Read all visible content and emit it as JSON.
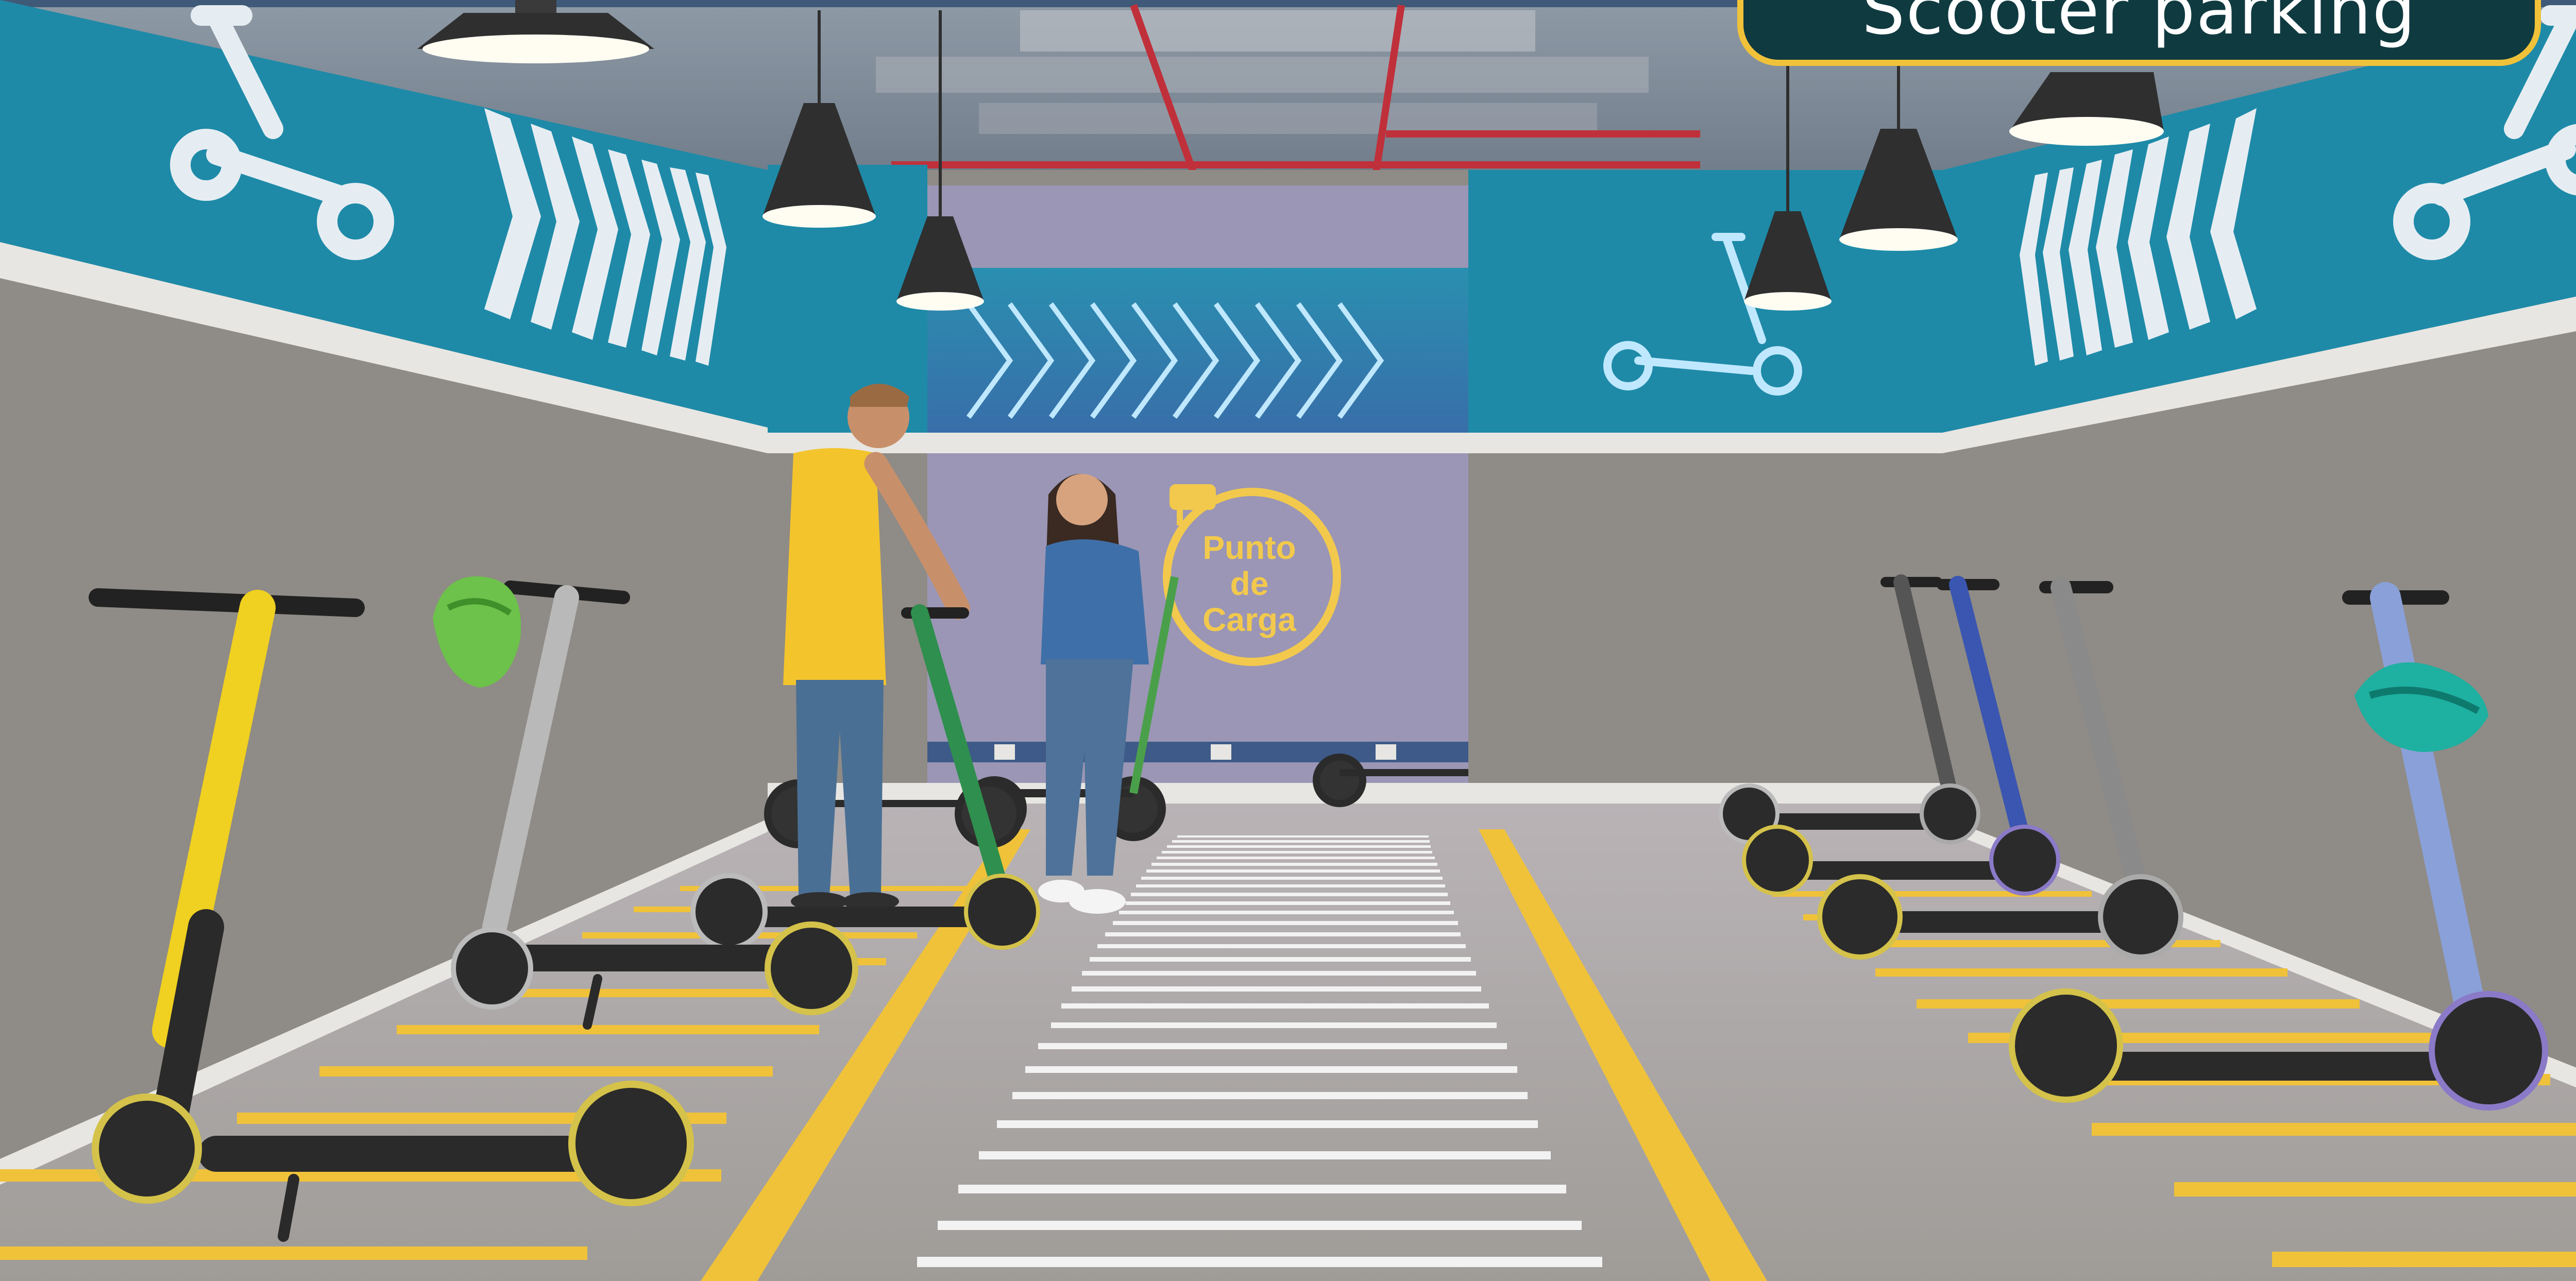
{
  "header": {
    "title": "Scooter parking"
  },
  "charging_sign": {
    "line1": "Punto",
    "line2": "de",
    "line3": "Carga"
  },
  "colors": {
    "teal_wall": "#1e8aa8",
    "concrete_wall": "#8f8b86",
    "floor": "#a9a6a2",
    "yellow_marking": "#f0c23a",
    "badge_bg": "#0f3a40",
    "neon": "#bfe8ff"
  }
}
